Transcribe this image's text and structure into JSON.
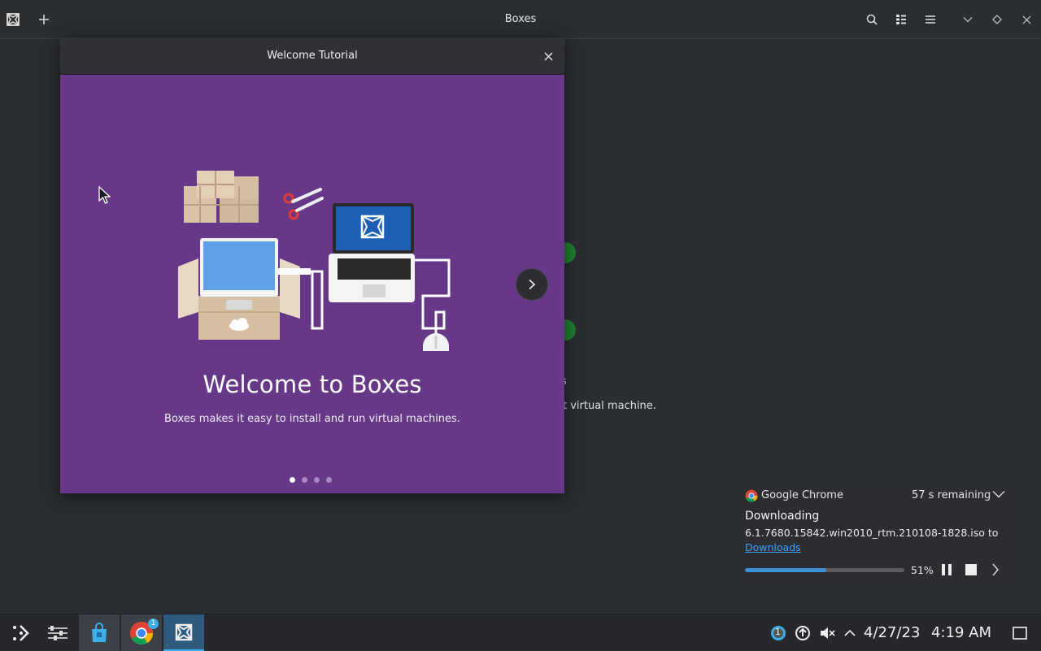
{
  "app": {
    "title": "Boxes",
    "empty_partial_1": "s",
    "empty_partial_2": "t virtual machine."
  },
  "dialog": {
    "title": "Welcome Tutorial",
    "close_icon": "close-icon",
    "heading": "Welcome to Boxes",
    "subtitle": "Boxes makes it easy to install and run virtual machines.",
    "page_count": 4,
    "current_page": 1
  },
  "download": {
    "app_name": "Google Chrome",
    "remaining": "57 s remaining",
    "heading": "Downloading",
    "file": "6.1.7680.15842.win2010_rtm.210108-1828.iso to",
    "link": "Downloads",
    "progress": 51,
    "progress_label": "51%"
  },
  "taskbar": {
    "chrome_badge": "1",
    "tray_badge": "1",
    "date": "4/27/23",
    "time": "4:19 AM"
  },
  "colors": {
    "dialog_bg": "#663887",
    "accent": "#3daee9",
    "link": "#3ea2ff"
  }
}
